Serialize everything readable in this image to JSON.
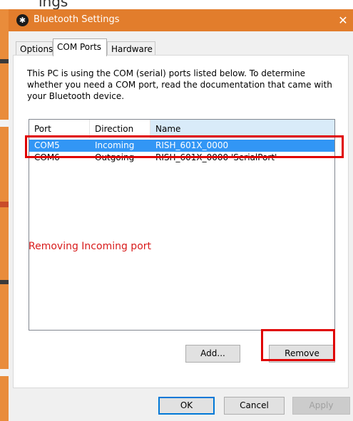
{
  "background": {
    "top_fragment": "ings"
  },
  "window": {
    "title": "Bluetooth Settings",
    "title_icon": "bluetooth-icon",
    "close_glyph": "✕",
    "accent_color": "#e27d2c"
  },
  "tabs": [
    {
      "label": "Options",
      "active": false
    },
    {
      "label": "COM Ports",
      "active": true
    },
    {
      "label": "Hardware",
      "active": false
    }
  ],
  "description": "This PC is using the COM (serial) ports listed below. To determine whether you need a COM port, read the documentation that came with your Bluetooth device.",
  "list": {
    "columns": [
      "Port",
      "Direction",
      "Name"
    ],
    "rows": [
      {
        "port": "COM5",
        "direction": "Incoming",
        "name": "RISH_601X_0000",
        "selected": true
      },
      {
        "port": "COM6",
        "direction": "Outgoing",
        "name": "RISH_601X_0000 'SerialPort'",
        "selected": false
      }
    ],
    "selection_color": "#3296f5"
  },
  "annotation": {
    "text": "Removing Incoming port",
    "color": "#d81b1b"
  },
  "buttons": {
    "add": "Add...",
    "remove": "Remove",
    "ok": "OK",
    "cancel": "Cancel",
    "apply": "Apply"
  },
  "highlight_color": "#e00000"
}
